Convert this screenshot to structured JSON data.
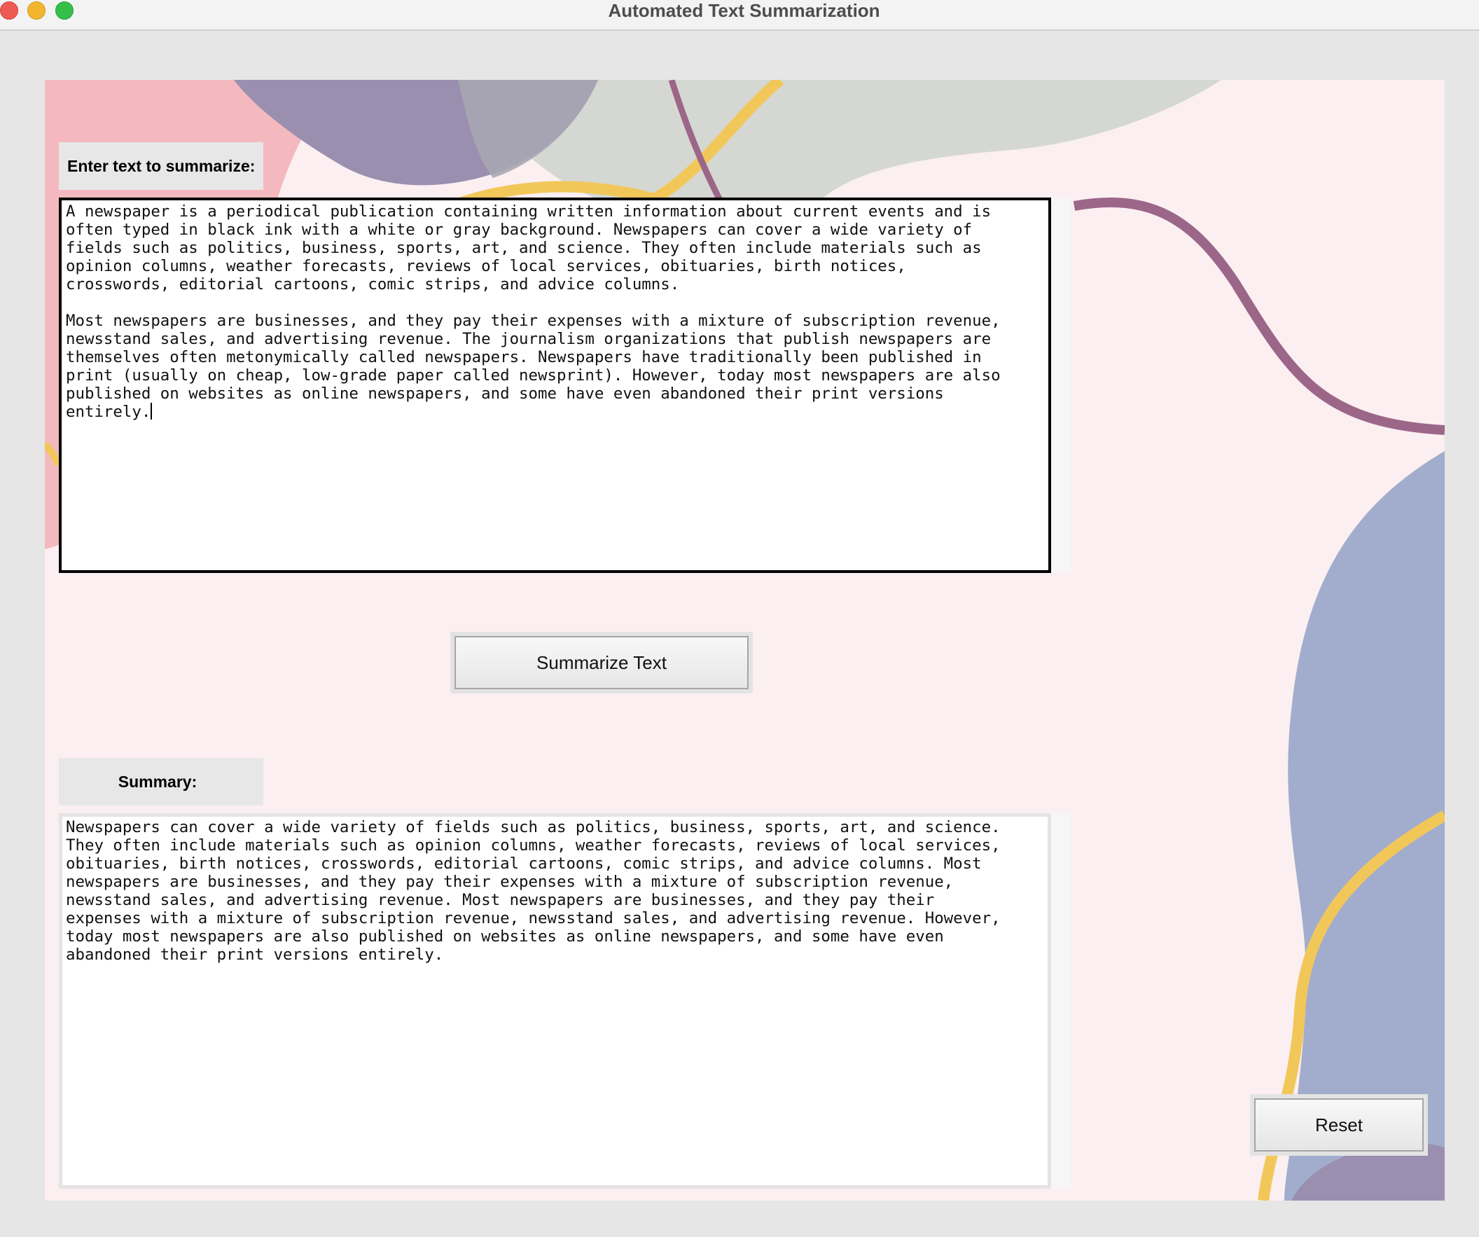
{
  "window": {
    "title": "Automated Text Summarization"
  },
  "input_section": {
    "label": "Enter text to summarize:",
    "text": "A newspaper is a periodical publication containing written information about current events and is\noften typed in black ink with a white or gray background. Newspapers can cover a wide variety of\nfields such as politics, business, sports, art, and science. They often include materials such as\nopinion columns, weather forecasts, reviews of local services, obituaries, birth notices,\ncrosswords, editorial cartoons, comic strips, and advice columns.\n\nMost newspapers are businesses, and they pay their expenses with a mixture of subscription revenue,\nnewsstand sales, and advertising revenue. The journalism organizations that publish newspapers are\nthemselves often metonymically called newspapers. Newspapers have traditionally been published in\nprint (usually on cheap, low-grade paper called newsprint). However, today most newspapers are also\npublished on websites as online newspapers, and some have even abandoned their print versions\nentirely."
  },
  "buttons": {
    "summarize_label": "Summarize Text",
    "reset_label": "Reset"
  },
  "summary_section": {
    "label": "Summary:",
    "text": "Newspapers can cover a wide variety of fields such as politics, business, sports, art, and science.\nThey often include materials such as opinion columns, weather forecasts, reviews of local services,\nobituaries, birth notices, crosswords, editorial cartoons, comic strips, and advice columns. Most\nnewspapers are businesses, and they pay their expenses with a mixture of subscription revenue,\nnewsstand sales, and advertising revenue. Most newspapers are businesses, and they pay their\nexpenses with a mixture of subscription revenue, newsstand sales, and advertising revenue. However,\ntoday most newspapers are also published on websites as online newspapers, and some have even\nabandoned their print versions entirely."
  },
  "colors": {
    "window_background": "#e6e6e6",
    "panel_background": "#fbeff1",
    "blob_pink": "#f4b9be",
    "blob_purple": "#9b8fb0",
    "blob_gray": "#d3d6d0",
    "blob_blue": "#a2adcd",
    "line_yellow": "#f2c75a",
    "line_plum": "#9c6689"
  }
}
